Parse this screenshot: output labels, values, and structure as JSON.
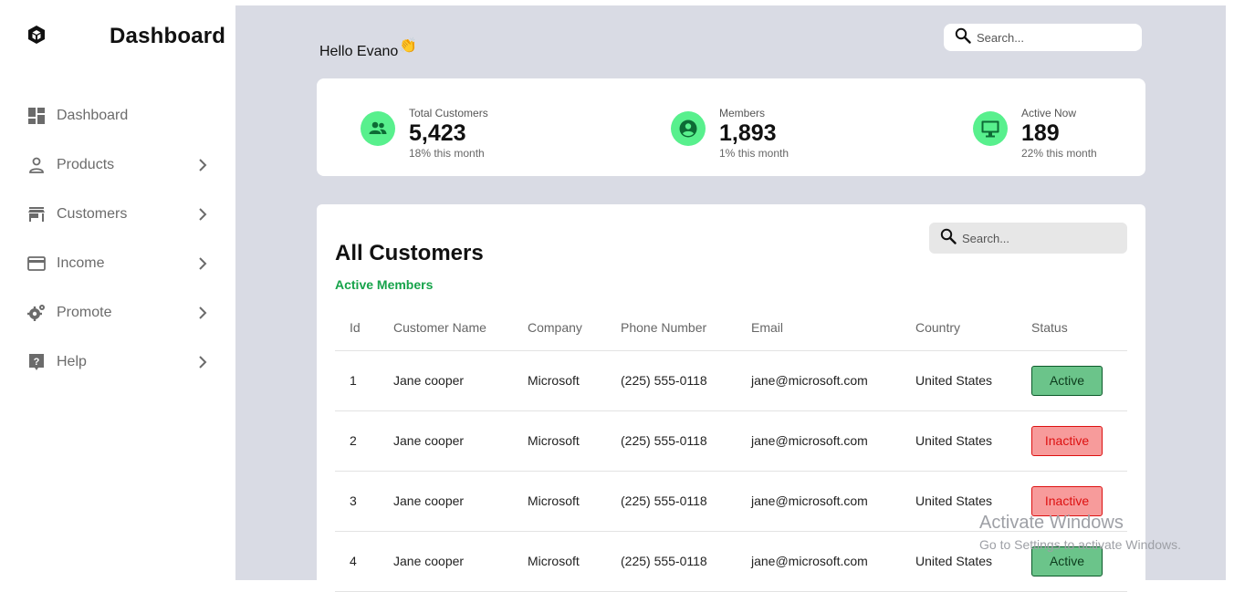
{
  "brand": {
    "title": "Dashboard",
    "logo_icon": "cube-icon"
  },
  "sidebar": {
    "items": [
      {
        "label": "Dashboard",
        "icon": "grid-icon",
        "has_chevron": false
      },
      {
        "label": "Products",
        "icon": "user-icon",
        "has_chevron": true
      },
      {
        "label": "Customers",
        "icon": "store-icon",
        "has_chevron": true
      },
      {
        "label": "Income",
        "icon": "credit-card-icon",
        "has_chevron": true
      },
      {
        "label": "Promote",
        "icon": "gears-icon",
        "has_chevron": true
      },
      {
        "label": "Help",
        "icon": "help-icon",
        "has_chevron": true
      }
    ]
  },
  "header": {
    "greeting": "Hello Evano",
    "greeting_emoji": "👏",
    "search_placeholder": "Search..."
  },
  "stats": [
    {
      "label": "Total Customers",
      "value": "5,423",
      "trend": "18% this month",
      "icon": "people-icon"
    },
    {
      "label": "Members",
      "value": "1,893",
      "trend": "1% this month",
      "icon": "account-circle-icon"
    },
    {
      "label": "Active Now",
      "value": "189",
      "trend": "22% this month",
      "icon": "monitor-icon"
    }
  ],
  "customers": {
    "title": "All Customers",
    "subtitle": "Active Members",
    "search_placeholder": "Search...",
    "columns": [
      "Id",
      "Customer Name",
      "Company",
      "Phone Number",
      "Email",
      "Country",
      "Status"
    ],
    "rows": [
      {
        "id": "1",
        "name": "Jane cooper",
        "company": "Microsoft",
        "phone": "(225) 555-0118",
        "email": "jane@microsoft.com",
        "country": "United States",
        "status": "Active"
      },
      {
        "id": "2",
        "name": "Jane cooper",
        "company": "Microsoft",
        "phone": "(225) 555-0118",
        "email": "jane@microsoft.com",
        "country": "United States",
        "status": "Inactive"
      },
      {
        "id": "3",
        "name": "Jane cooper",
        "company": "Microsoft",
        "phone": "(225) 555-0118",
        "email": "jane@microsoft.com",
        "country": "United States",
        "status": "Inactive"
      },
      {
        "id": "4",
        "name": "Jane cooper",
        "company": "Microsoft",
        "phone": "(225) 555-0118",
        "email": "jane@microsoft.com",
        "country": "United States",
        "status": "Active"
      }
    ]
  },
  "watermark": {
    "line1": "Activate Windows",
    "line2": "Go to Settings to activate Windows."
  },
  "colors": {
    "accent_green": "#58f08d",
    "active_status": "#6bc48a",
    "inactive_status": "#f79b9b",
    "main_bg": "#d9dbe4"
  }
}
